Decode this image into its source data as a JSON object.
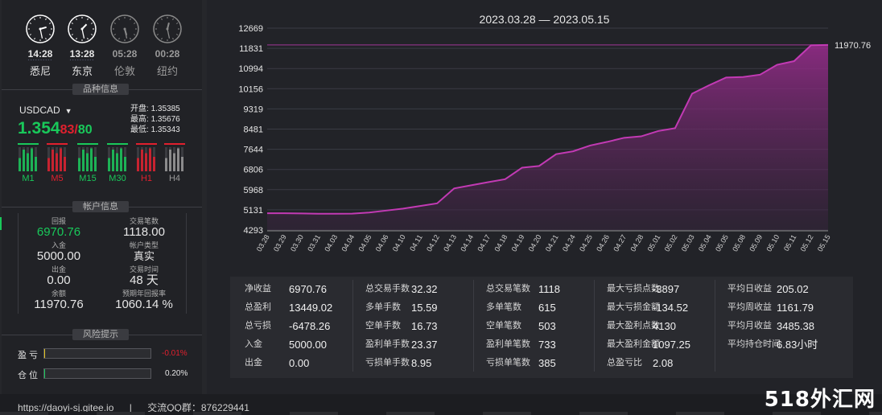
{
  "clocks": [
    {
      "time": "14:28",
      "city": "悉尼",
      "active": true
    },
    {
      "time": "13:28",
      "city": "东京",
      "active": true
    },
    {
      "time": "05:28",
      "city": "伦敦",
      "active": false
    },
    {
      "time": "00:28",
      "city": "纽约",
      "active": false
    }
  ],
  "sections": {
    "product": "品种信息",
    "account": "帐户信息",
    "risk": "风险提示"
  },
  "product": {
    "symbol": "USDCAD",
    "price_main": "1.354",
    "price_small": "83",
    "price_sep": "/",
    "price_alt": "80",
    "open_label": "开盘:",
    "open": "1.35385",
    "high_label": "最高:",
    "high": "1.35676",
    "low_label": "最低:",
    "low": "1.35343",
    "timeframes": [
      {
        "label": "M1",
        "trend": "up"
      },
      {
        "label": "M5",
        "trend": "down"
      },
      {
        "label": "M15",
        "trend": "up"
      },
      {
        "label": "M30",
        "trend": "up"
      },
      {
        "label": "H1",
        "trend": "down"
      },
      {
        "label": "H4",
        "trend": "neutral"
      }
    ]
  },
  "account": {
    "return_label": "回报",
    "return": "6970.76",
    "trades_label": "交易笔数",
    "trades": "1118.00",
    "deposit_label": "入金",
    "deposit": "5000.00",
    "type_label": "帐户类型",
    "type": "真实",
    "withdraw_label": "出金",
    "withdraw": "0.00",
    "time_label": "交易时间",
    "time": "48 天",
    "balance_label": "余额",
    "balance": "11970.76",
    "annual_label": "预期年回报率",
    "annual": "1060.14 %"
  },
  "risk": {
    "profit_label": "盈 亏",
    "profit_value": "-0.01%",
    "profit_level": 0.01,
    "position_label": "仓 位",
    "position_value": "0.20%",
    "position_level": 0.002
  },
  "chart_title": "2023.03.28 — 2023.05.15",
  "chart_data": {
    "type": "area",
    "title": "2023.03.28 — 2023.05.15",
    "categories": [
      "03.28",
      "03.29",
      "03.30",
      "03.31",
      "04.03",
      "04.04",
      "04.05",
      "04.06",
      "04.10",
      "04.11",
      "04.12",
      "04.13",
      "04.14",
      "04.17",
      "04.18",
      "04.19",
      "04.20",
      "04.21",
      "04.24",
      "04.25",
      "04.26",
      "04.27",
      "04.28",
      "05.01",
      "05.02",
      "05.03",
      "05.04",
      "05.05",
      "05.08",
      "05.09",
      "05.10",
      "05.11",
      "05.12",
      "05.15"
    ],
    "values": [
      4990,
      4990,
      4980,
      4970,
      4970,
      4975,
      5020,
      5100,
      5180,
      5290,
      5400,
      6020,
      6150,
      6280,
      6400,
      6880,
      6950,
      7440,
      7560,
      7800,
      7950,
      8120,
      8180,
      8400,
      8520,
      9950,
      10300,
      10620,
      10640,
      10740,
      11150,
      11300,
      11960,
      11970.76
    ],
    "yticks": [
      4293,
      5131,
      5968,
      6806,
      7644,
      8481,
      9319,
      10156,
      10994,
      11831,
      12669
    ],
    "ylim": [
      4293,
      12669
    ],
    "last_label": "11970.76",
    "grid": true,
    "color": "#c23ab4"
  },
  "stats": [
    [
      {
        "k": "净收益",
        "v": "6970.76"
      },
      {
        "k": "总盈利",
        "v": "13449.02"
      },
      {
        "k": "总亏损",
        "v": "-6478.26"
      },
      {
        "k": "入金",
        "v": "5000.00"
      },
      {
        "k": "出金",
        "v": "0.00"
      }
    ],
    [
      {
        "k": "总交易手数",
        "v": "32.32"
      },
      {
        "k": "多单手数",
        "v": "15.59"
      },
      {
        "k": "空单手数",
        "v": "16.73"
      },
      {
        "k": "盈利单手数",
        "v": "23.37"
      },
      {
        "k": "亏损单手数",
        "v": "8.95"
      }
    ],
    [
      {
        "k": "总交易笔数",
        "v": "1118"
      },
      {
        "k": "多单笔数",
        "v": "615"
      },
      {
        "k": "空单笔数",
        "v": "503"
      },
      {
        "k": "盈利单笔数",
        "v": "733"
      },
      {
        "k": "亏损单笔数",
        "v": "385"
      }
    ],
    [
      {
        "k": "最大亏损点数",
        "v": "-3897"
      },
      {
        "k": "最大亏损金额",
        "v": "-134.52"
      },
      {
        "k": "最大盈利点数",
        "v": "4130"
      },
      {
        "k": "最大盈利金额",
        "v": "1097.25"
      },
      {
        "k": "总盈亏比",
        "v": "2.08"
      }
    ],
    [
      {
        "k": "平均日收益",
        "v": "205.02"
      },
      {
        "k": "平均周收益",
        "v": "1161.79"
      },
      {
        "k": "平均月收益",
        "v": "3485.38"
      },
      {
        "k": "平均持仓时间",
        "v": "6.83小时"
      }
    ]
  ],
  "footer": {
    "site": "https://daoyi-sj.gitee.io",
    "sep": "|",
    "qq": "交流QQ群：876229441"
  },
  "watermark": "518外汇网",
  "colors": {
    "green": "#19c85a",
    "red": "#e0202e",
    "line": "#c23ab4"
  }
}
